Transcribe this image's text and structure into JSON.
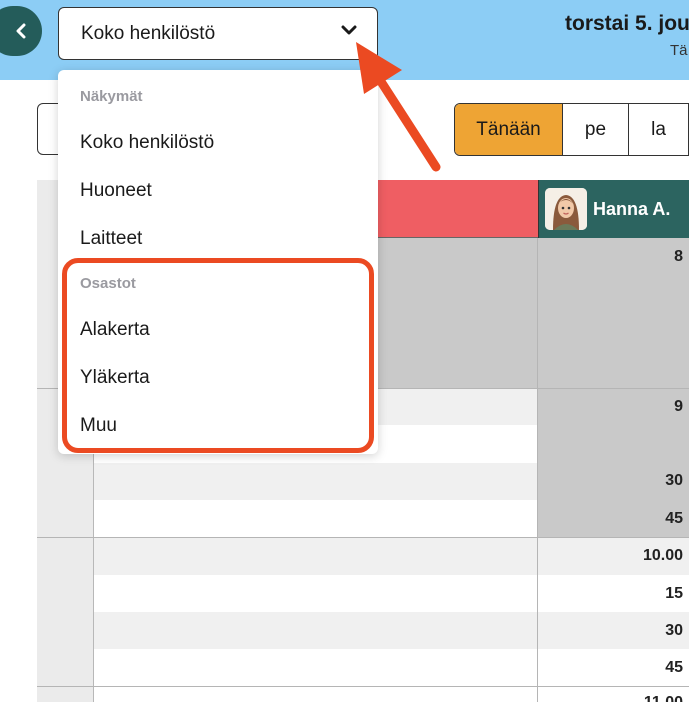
{
  "header": {
    "view_select_value": "Koko henkilöstö",
    "date_title": "torstai 5. jou",
    "date_sub": "Tä"
  },
  "toolbar": {
    "today_label": "Tänään",
    "day1": "pe",
    "day2": "la"
  },
  "dropdown": {
    "group_views": "Näkymät",
    "options_views": [
      "Koko henkilöstö",
      "Huoneet",
      "Laitteet"
    ],
    "group_departments": "Osastot",
    "options_departments": [
      "Alakerta",
      "Yläkerta",
      "Muu"
    ]
  },
  "calendar": {
    "resource_name": "Hanna A.",
    "time_labels": [
      "8",
      "9",
      "30",
      "45",
      "10.00",
      "15",
      "30",
      "45",
      "11.00"
    ]
  },
  "colors": {
    "header_bg": "#8ccdf5",
    "back_btn": "#245c5a",
    "today_btn": "#eea434",
    "resource_red": "#ef5e63",
    "resource_green": "#2c6460",
    "highlight": "#eb4a22"
  },
  "icons": {
    "back": "chevron-left-icon",
    "select": "chevron-down-icon",
    "arrow": "annotation-arrow-icon"
  }
}
